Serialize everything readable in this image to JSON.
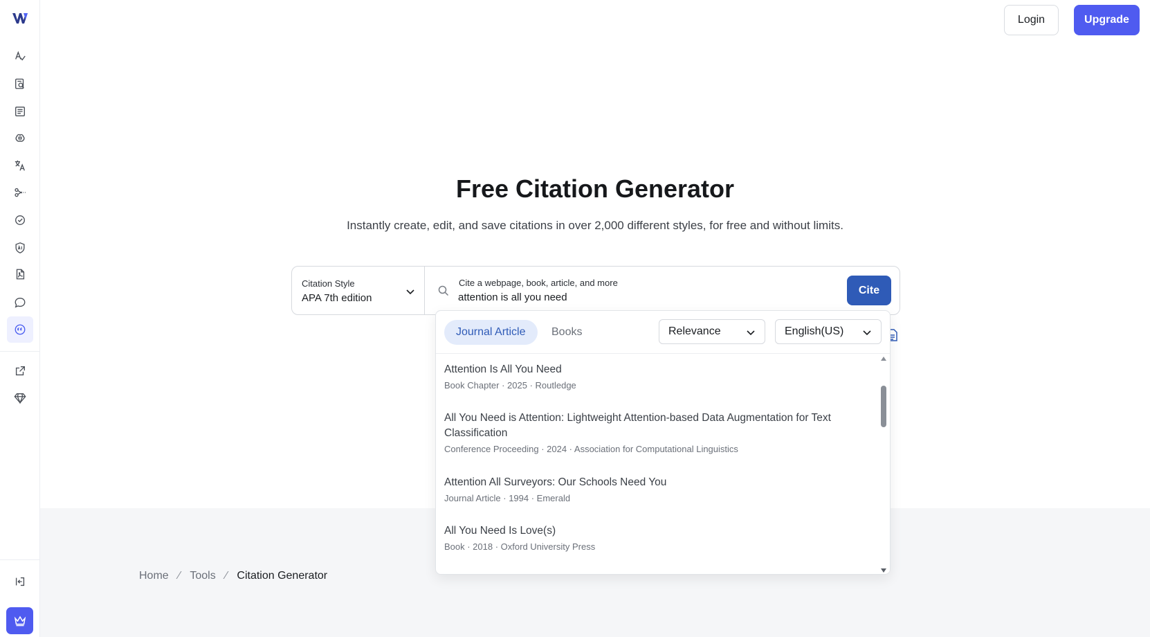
{
  "header": {
    "login_label": "Login",
    "upgrade_label": "Upgrade"
  },
  "hero": {
    "title": "Free Citation Generator",
    "subtitle": "Instantly create, edit, and save citations in over 2,000 different styles, for free and without limits."
  },
  "citation_style": {
    "label": "Citation Style",
    "value": "APA 7th edition"
  },
  "search": {
    "label": "Cite a webpage, book, article, and more",
    "value": "attention is all you need",
    "cite_label": "Cite"
  },
  "dropdown": {
    "tabs": [
      {
        "label": "Journal Article",
        "active": true
      },
      {
        "label": "Books",
        "active": false
      }
    ],
    "sort_value": "Relevance",
    "language_value": "English(US)",
    "results": [
      {
        "title": "Attention Is All You Need",
        "meta": "Book Chapter · 2025 · Routledge"
      },
      {
        "title": "All You Need is Attention: Lightweight Attention-based Data Augmentation for Text Classification",
        "meta": "Conference Proceeding · 2024 · Association for Computational Linguistics"
      },
      {
        "title": "Attention All Surveyors: Our Schools Need You",
        "meta": "Journal Article · 1994 · Emerald"
      },
      {
        "title": "All You Need Is Love(s)",
        "meta": "Book · 2018 · Oxford University Press"
      }
    ]
  },
  "breadcrumb": {
    "items": [
      "Home",
      "Tools",
      "Citation Generator"
    ]
  },
  "colors": {
    "accent": "#4f5bf0",
    "cite_button": "#2f5bb7",
    "active_tab_bg": "#e3ebfb"
  },
  "sidebar": {
    "icons": [
      "grammar-icon",
      "search-document-icon",
      "list-document-icon",
      "brain-icon",
      "translate-icon",
      "scissors-icon",
      "check-circle-icon",
      "ai-shield-icon",
      "pdf-icon",
      "chat-icon",
      "citation-icon",
      "external-link-icon",
      "diamond-icon",
      "logout-icon",
      "crown-icon"
    ]
  }
}
